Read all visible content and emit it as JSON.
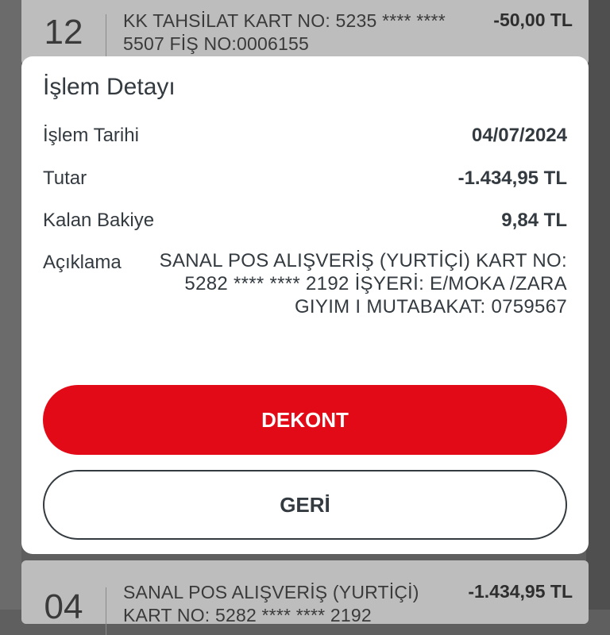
{
  "background_list": [
    {
      "day": "12",
      "description": "KK TAHSİLAT KART NO: 5235 **** **** 5507 FİŞ NO:0006155",
      "amount": "-50,00 TL"
    },
    {
      "day": "04",
      "description": "SANAL POS ALIŞVERİŞ (YURTİÇİ) KART NO: 5282 **** **** 2192",
      "amount": "-1.434,95 TL"
    }
  ],
  "modal": {
    "title": "İşlem Detayı",
    "date_label": "İşlem Tarihi",
    "date_value": "04/07/2024",
    "amount_label": "Tutar",
    "amount_value": "-1.434,95 TL",
    "balance_label": "Kalan Bakiye",
    "balance_value": "9,84 TL",
    "description_label": "Açıklama",
    "description_value": "SANAL POS ALIŞVERİŞ (YURTİÇİ) KART NO: 5282 **** **** 2192 İŞYERİ: E/MOKA /ZARA GIYIM I MUTABAKAT: 0759567",
    "receipt_button": "DEKONT",
    "back_button": "GERİ"
  },
  "colors": {
    "accent": "#e30a17",
    "text": "#333a40",
    "overlay": "#5f5f5f"
  }
}
